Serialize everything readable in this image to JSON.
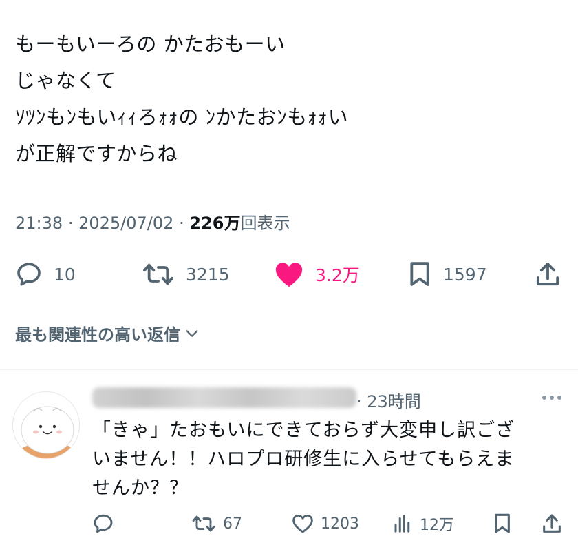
{
  "tweet": {
    "lines": [
      "もーもいーろの かたおもーい",
      "じゃなくて",
      "ｿﾂﾝもﾝもいｨｨろｫｫの ﾝかたおﾝもｫｫい",
      "が正解ですからね"
    ],
    "time": "21:38",
    "date": "2025/07/02",
    "views_count": "226万",
    "views_label": "回表示",
    "separator": "·"
  },
  "actions": {
    "reply_count": "10",
    "retweet_count": "3215",
    "like_count": "3.2万",
    "bookmark_count": "1597",
    "like_color": "#f91880"
  },
  "sort_label": "最も関連性の高い返信",
  "reply": {
    "time_ago": "23時間",
    "lines": [
      "「きゃ」たおもいにできておらず大変申し訳ござ",
      "いません！！ハロプロ研修生に入らせてもらえま",
      "せんか？？"
    ],
    "retweet_count": "67",
    "like_count": "1203",
    "views_count": "12万"
  },
  "icons": {
    "reply": "speech-bubble-icon",
    "retweet": "retweet-arrows-icon",
    "like": "heart-icon",
    "bookmark": "bookmark-icon",
    "share": "share-upload-icon",
    "views": "bar-chart-icon",
    "more": "more-dots-icon",
    "chevron": "chevron-down-icon"
  }
}
